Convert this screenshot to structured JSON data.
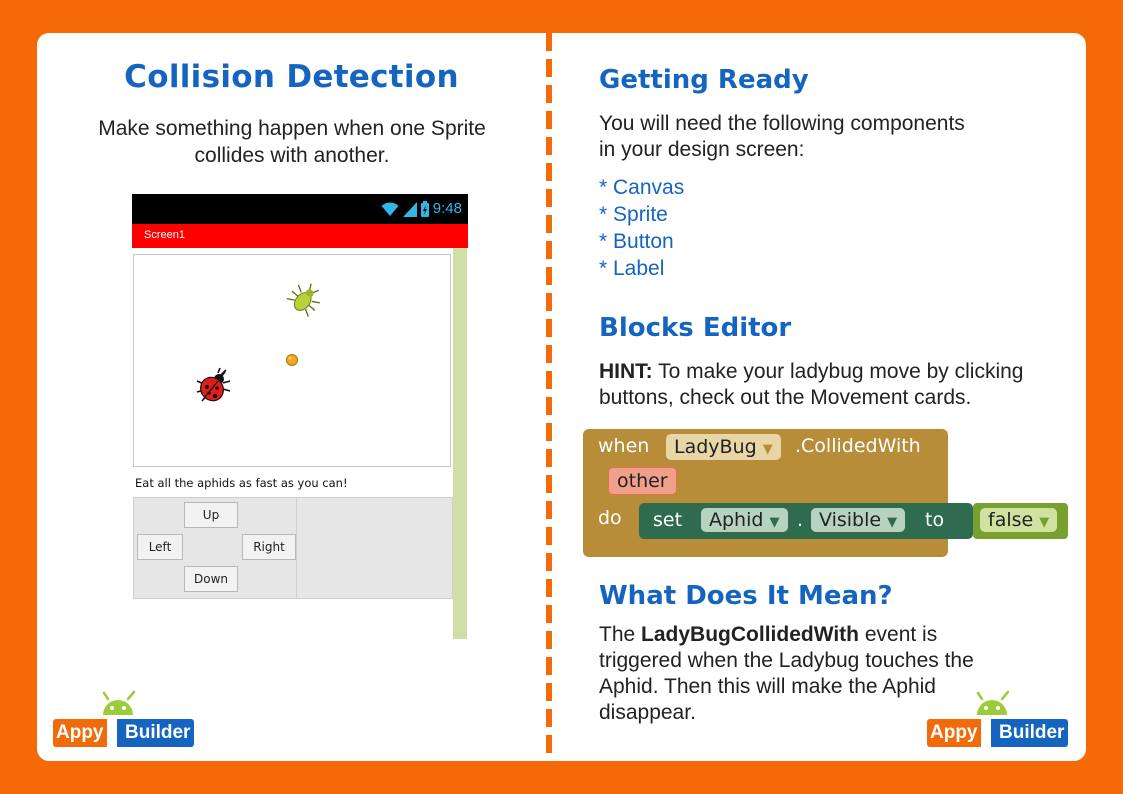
{
  "left": {
    "title": "Collision Detection",
    "subtitle": "Make something happen when one Sprite collides with another.",
    "phone": {
      "time": "9:48",
      "screen_title": "Screen1",
      "canvas_caption": "Eat all the aphids as fast as you can!",
      "buttons": {
        "up": "Up",
        "left": "Left",
        "right": "Right",
        "down": "Down"
      }
    }
  },
  "right": {
    "getting_ready": {
      "heading": "Getting Ready",
      "intro_line1": "You will need the following components",
      "intro_line2": "in your design screen:",
      "components": [
        "* Canvas",
        "* Sprite",
        "* Button",
        "* Label"
      ]
    },
    "blocks_editor": {
      "heading": "Blocks Editor",
      "hint_label": "HINT:",
      "hint_line1": " To make your ladybug move by clicking",
      "hint_line2": "buttons, check out the Movement cards.",
      "block": {
        "when": "when",
        "component": "LadyBug",
        "event": ".CollidedWith",
        "param": "other",
        "do": "do",
        "set": "set",
        "target": "Aphid",
        "dot": ".",
        "property": "Visible",
        "to": "to",
        "value": "false"
      }
    },
    "meaning": {
      "heading": "What Does It Mean?",
      "prefix": "The ",
      "event_name": "LadyBugCollidedWith",
      "line1_rest": " event is",
      "line2": "triggered when the Ladybug touches the",
      "line3": "Aphid. Then this will make the Aphid",
      "line4": "disappear."
    }
  },
  "logo": {
    "appy": "Appy",
    "builder": "Builder"
  },
  "colors": {
    "background": "#f36a07",
    "heading_blue": "#1565c0",
    "event_block": "#b78d3a",
    "set_block": "#2e6b4f",
    "logic_block": "#78a02e"
  }
}
